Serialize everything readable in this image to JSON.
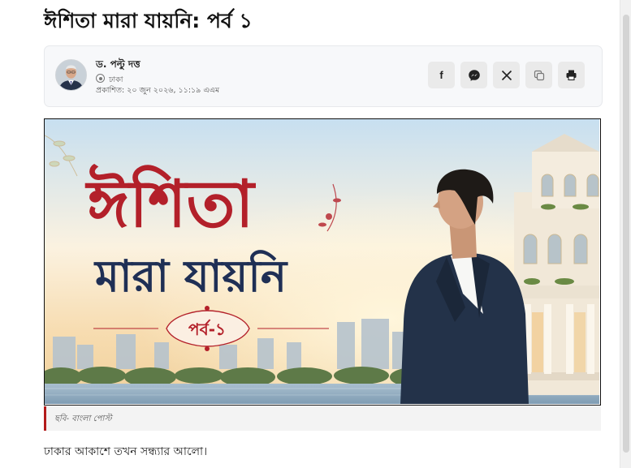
{
  "article": {
    "title": "ঈশিতা মারা যায়নি: পর্ব ১",
    "first_paragraph": "ঢাকার আকাশে তখন সন্ধ্যার আলো।"
  },
  "byline": {
    "author": "ড. পল্টু দত্ত",
    "location": "ঢাকা",
    "published": "প্রকাশিত: ২০ জুন ২০২৬, ১১:১৯ এএম"
  },
  "share_buttons": [
    {
      "name": "facebook",
      "icon": "facebook-icon"
    },
    {
      "name": "messenger",
      "icon": "messenger-icon"
    },
    {
      "name": "x",
      "icon": "x-icon"
    },
    {
      "name": "copy-link",
      "icon": "copy-icon"
    },
    {
      "name": "print",
      "icon": "print-icon"
    }
  ],
  "hero_image": {
    "headline_line1": "ঈশিতা",
    "headline_line2": "মারা যায়নি",
    "episode_badge": "পর্ব-১",
    "caption": "ছবি- বাংলা পোস্ট"
  },
  "colors": {
    "headline_red": "#b3202a",
    "headline_navy": "#1f2f55",
    "caption_accent": "#b31b1b",
    "card_background": "#f7f8fa"
  }
}
